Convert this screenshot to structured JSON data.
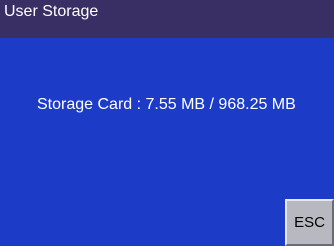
{
  "window": {
    "title": "User Storage"
  },
  "storage": {
    "label": "Storage Card : 7.55 MB / 968.25 MB"
  },
  "buttons": {
    "esc_label": "ESC"
  },
  "colors": {
    "background": "#1c3cc8",
    "title_bar": "#3a2f64",
    "button_face": "#b8b8c0"
  }
}
